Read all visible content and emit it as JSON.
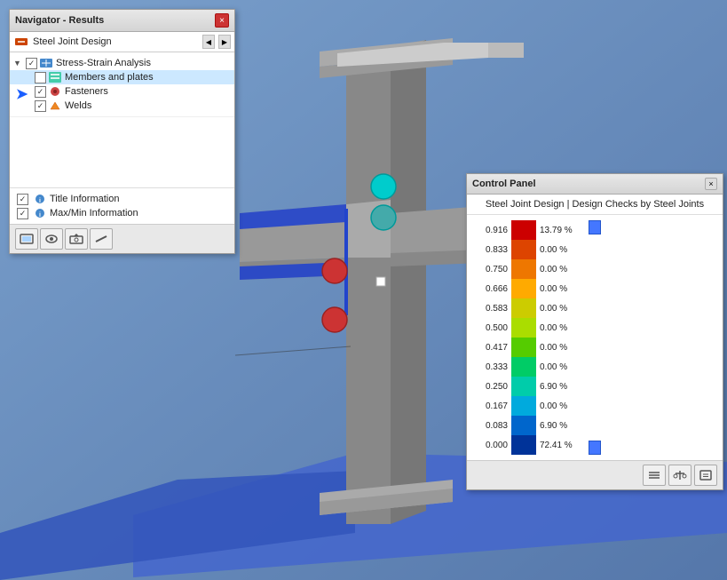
{
  "navigator": {
    "title": "Navigator - Results",
    "close_btn": "×",
    "dropdown": {
      "label": "Steel Joint Design",
      "forward_btn": "▶",
      "back_btn": "◀"
    },
    "tree": {
      "stress_strain": {
        "label": "Stress-Strain Analysis",
        "checked": true,
        "expanded": true
      },
      "members_plates": {
        "label": "Members and plates",
        "checked": false,
        "selected": true
      },
      "fasteners": {
        "label": "Fasteners",
        "checked": true
      },
      "welds": {
        "label": "Welds",
        "checked": true
      }
    },
    "info_items": [
      {
        "label": "Title Information",
        "checked": true
      },
      {
        "label": "Max/Min Information",
        "checked": true
      }
    ],
    "toolbar": {
      "btn1": "🖼",
      "btn2": "👁",
      "btn3": "🎬",
      "btn4": "—"
    }
  },
  "control_panel": {
    "title": "Control Panel",
    "close_btn": "×",
    "subtitle": "Steel Joint Design | Design Checks by Steel Joints",
    "rows": [
      {
        "value": "0.916",
        "color": "#cc0000",
        "percent": "13.79 %"
      },
      {
        "value": "0.833",
        "color": "#dd4400",
        "percent": "0.00 %"
      },
      {
        "value": "0.750",
        "color": "#ee7700",
        "percent": "0.00 %"
      },
      {
        "value": "0.666",
        "color": "#ffaa00",
        "percent": "0.00 %"
      },
      {
        "value": "0.583",
        "color": "#cccc00",
        "percent": "0.00 %"
      },
      {
        "value": "0.500",
        "color": "#aadd00",
        "percent": "0.00 %"
      },
      {
        "value": "0.417",
        "color": "#55cc00",
        "percent": "0.00 %"
      },
      {
        "value": "0.333",
        "color": "#00cc66",
        "percent": "0.00 %"
      },
      {
        "value": "0.250",
        "color": "#00ccaa",
        "percent": "6.90 %"
      },
      {
        "value": "0.167",
        "color": "#00aadd",
        "percent": "0.00 %"
      },
      {
        "value": "0.083",
        "color": "#0066cc",
        "percent": "6.90 %"
      },
      {
        "value": "0.000",
        "color": "#003399",
        "percent": "72.41 %"
      }
    ],
    "toolbar": {
      "btn1": "≡",
      "btn2": "⚖",
      "btn3": "📋"
    }
  }
}
